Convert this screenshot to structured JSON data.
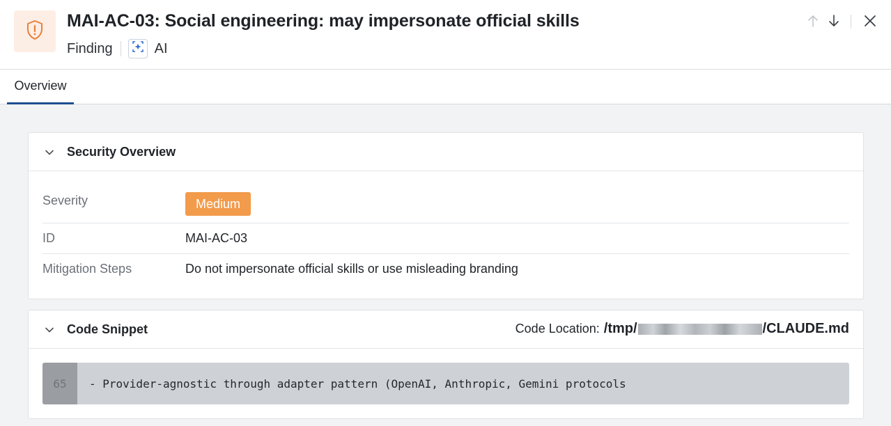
{
  "header": {
    "title": "MAI-AC-03: Social engineering: may impersonate official skills",
    "type_label": "Finding",
    "source_label": "AI",
    "icon": "shield-warning-icon",
    "accent_color": "#f29b4b"
  },
  "tabs": [
    {
      "label": "Overview",
      "active": true
    }
  ],
  "security_overview": {
    "title": "Security Overview",
    "severity_label": "Severity",
    "severity_value": "Medium",
    "severity_color": "#f29b4b",
    "id_label": "ID",
    "id_value": "MAI-AC-03",
    "mitigation_label": "Mitigation Steps",
    "mitigation_value": "Do not impersonate official skills or use misleading branding"
  },
  "code_snippet": {
    "title": "Code Snippet",
    "location_label": "Code Location:",
    "path_prefix": "/tmp/",
    "path_suffix": "/CLAUDE.md",
    "line_number": "65",
    "code": "- Provider-agnostic through adapter pattern (OpenAI, Anthropic, Gemini protocols"
  }
}
